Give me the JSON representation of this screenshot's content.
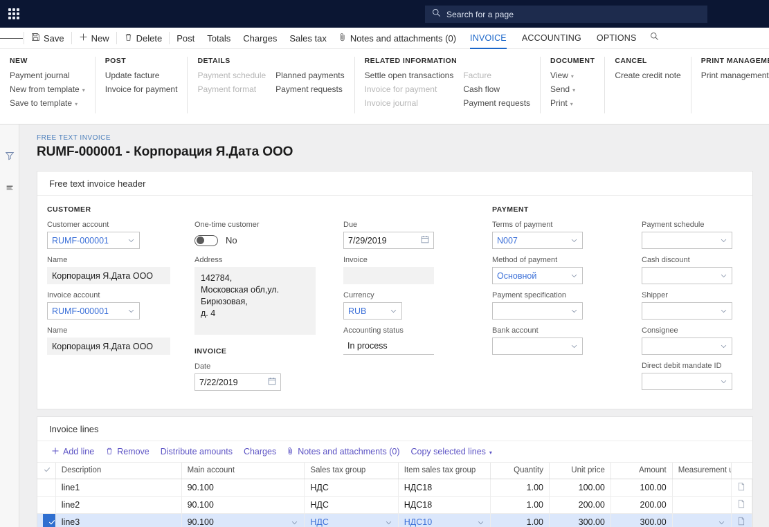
{
  "topbar": {
    "waffle_label": "App launcher",
    "search": {
      "placeholder": "Search for a page",
      "value": ""
    }
  },
  "commandbar": {
    "buttons": [
      {
        "label": "Save",
        "icon": "save-icon"
      },
      {
        "label": "New",
        "icon": "plus-icon"
      },
      {
        "label": "Delete",
        "icon": "trash-icon"
      },
      {
        "label": "Post",
        "icon": ""
      },
      {
        "label": "Totals",
        "icon": ""
      },
      {
        "label": "Charges",
        "icon": ""
      },
      {
        "label": "Sales tax",
        "icon": ""
      },
      {
        "label": "Notes and attachments (0)",
        "icon": "attachment-icon"
      }
    ],
    "tabs": [
      {
        "label": "INVOICE",
        "active": true
      },
      {
        "label": "ACCOUNTING",
        "active": false
      },
      {
        "label": "OPTIONS",
        "active": false
      }
    ]
  },
  "actionpane": {
    "groups": [
      {
        "title": "NEW",
        "columns": [
          [
            {
              "label": "Payment journal",
              "dim": false,
              "caret": false
            },
            {
              "label": "New from template",
              "dim": false,
              "caret": true
            },
            {
              "label": "Save to template",
              "dim": false,
              "caret": true
            }
          ]
        ]
      },
      {
        "title": "POST",
        "columns": [
          [
            {
              "label": "Update facture",
              "dim": false,
              "caret": false
            },
            {
              "label": "Invoice for payment",
              "dim": false,
              "caret": false
            }
          ]
        ]
      },
      {
        "title": "DETAILS",
        "columns": [
          [
            {
              "label": "Payment schedule",
              "dim": true,
              "caret": false
            },
            {
              "label": "Payment format",
              "dim": true,
              "caret": false
            }
          ],
          [
            {
              "label": "Planned payments",
              "dim": false,
              "caret": false
            },
            {
              "label": "Payment requests",
              "dim": false,
              "caret": false
            }
          ]
        ]
      },
      {
        "title": "RELATED INFORMATION",
        "columns": [
          [
            {
              "label": "Settle open transactions",
              "dim": false,
              "caret": false
            },
            {
              "label": "Invoice for payment",
              "dim": true,
              "caret": false
            },
            {
              "label": "Invoice journal",
              "dim": true,
              "caret": false
            }
          ],
          [
            {
              "label": "Facture",
              "dim": true,
              "caret": false
            },
            {
              "label": "Cash flow",
              "dim": false,
              "caret": false
            },
            {
              "label": "Payment requests",
              "dim": false,
              "caret": false
            }
          ]
        ]
      },
      {
        "title": "DOCUMENT",
        "columns": [
          [
            {
              "label": "View",
              "dim": false,
              "caret": true
            },
            {
              "label": "Send",
              "dim": false,
              "caret": true
            },
            {
              "label": "Print",
              "dim": false,
              "caret": true
            }
          ]
        ]
      },
      {
        "title": "CANCEL",
        "columns": [
          [
            {
              "label": "Create credit note",
              "dim": false,
              "caret": false
            }
          ]
        ]
      },
      {
        "title": "PRINT MANAGEMENT",
        "columns": [
          [
            {
              "label": "Print management",
              "dim": false,
              "caret": false
            }
          ]
        ]
      }
    ]
  },
  "leftrail": {
    "items": [
      {
        "name": "filter-icon"
      },
      {
        "name": "lines-icon"
      }
    ]
  },
  "page": {
    "breadcrumb": "FREE TEXT INVOICE",
    "title": "RUMF-000001 - Корпорация Я.Дата ООО"
  },
  "header_panel": {
    "title": "Free text invoice header",
    "customer": {
      "group_label": "CUSTOMER",
      "customer_account_label": "Customer account",
      "customer_account_value": "RUMF-000001",
      "name_label": "Name",
      "name_value": "Корпорация Я.Дата ООО",
      "invoice_account_label": "Invoice account",
      "invoice_account_value": "RUMF-000001",
      "name2_label": "Name",
      "name2_value": "Корпорация Я.Дата ООО"
    },
    "middle": {
      "onetime_label": "One-time customer",
      "onetime_value": "No",
      "address_label": "Address",
      "address_value": "142784,\nМосковская обл,ул. Бирюзовая,\nд. 4",
      "invoice_group_label": "INVOICE",
      "date_label": "Date",
      "date_value": "7/22/2019"
    },
    "dates": {
      "due_label": "Due",
      "due_value": "7/29/2019",
      "invoice_label": "Invoice",
      "invoice_value": "",
      "currency_label": "Currency",
      "currency_value": "RUB",
      "accounting_status_label": "Accounting status",
      "accounting_status_value": "In process"
    },
    "payment": {
      "group_label": "PAYMENT",
      "terms_label": "Terms of payment",
      "terms_value": "N007",
      "method_label": "Method of payment",
      "method_value": "Основной",
      "spec_label": "Payment specification",
      "spec_value": "",
      "bank_label": "Bank account",
      "bank_value": ""
    },
    "extras": {
      "payment_schedule_label": "Payment schedule",
      "payment_schedule_value": "",
      "cash_discount_label": "Cash discount",
      "cash_discount_value": "",
      "shipper_label": "Shipper",
      "shipper_value": "",
      "consignee_label": "Consignee",
      "consignee_value": "",
      "ddm_label": "Direct debit mandate ID",
      "ddm_value": ""
    }
  },
  "lines_panel": {
    "title": "Invoice lines",
    "toolbar": [
      {
        "label": "Add line",
        "icon": "plus-icon"
      },
      {
        "label": "Remove",
        "icon": "trash-icon"
      },
      {
        "label": "Distribute amounts",
        "icon": ""
      },
      {
        "label": "Charges",
        "icon": ""
      },
      {
        "label": "Notes and attachments (0)",
        "icon": "attachment-icon"
      },
      {
        "label": "Copy selected lines",
        "icon": "",
        "caret": true
      }
    ],
    "columns": [
      "Description",
      "Main account",
      "Sales tax group",
      "Item sales tax group",
      "Quantity",
      "Unit price",
      "Amount",
      "Measurement u..."
    ],
    "rows": [
      {
        "selected": false,
        "description": "line1",
        "main_account": "90.100",
        "sales_tax_group": "НДС",
        "item_sales_tax_group": "НДС18",
        "quantity": "1.00",
        "unit_price": "100.00",
        "amount": "100.00",
        "measurement_unit": ""
      },
      {
        "selected": false,
        "description": "line2",
        "main_account": "90.100",
        "sales_tax_group": "НДС",
        "item_sales_tax_group": "НДС18",
        "quantity": "1.00",
        "unit_price": "200.00",
        "amount": "200.00",
        "measurement_unit": ""
      },
      {
        "selected": true,
        "description": "line3",
        "main_account": "90.100",
        "sales_tax_group": "НДС",
        "item_sales_tax_group": "НДС10",
        "quantity": "1.00",
        "unit_price": "300.00",
        "amount": "300.00",
        "measurement_unit": ""
      }
    ]
  },
  "colors": {
    "nav_bg": "#0b1633",
    "accent_blue": "#1a66c9",
    "link_value_blue": "#3a6fd8",
    "toolbar_link": "#5b52c4",
    "selected_row": "#dbe7fb",
    "selected_check": "#2f6fd0",
    "canvas_bg": "#efeff0"
  }
}
